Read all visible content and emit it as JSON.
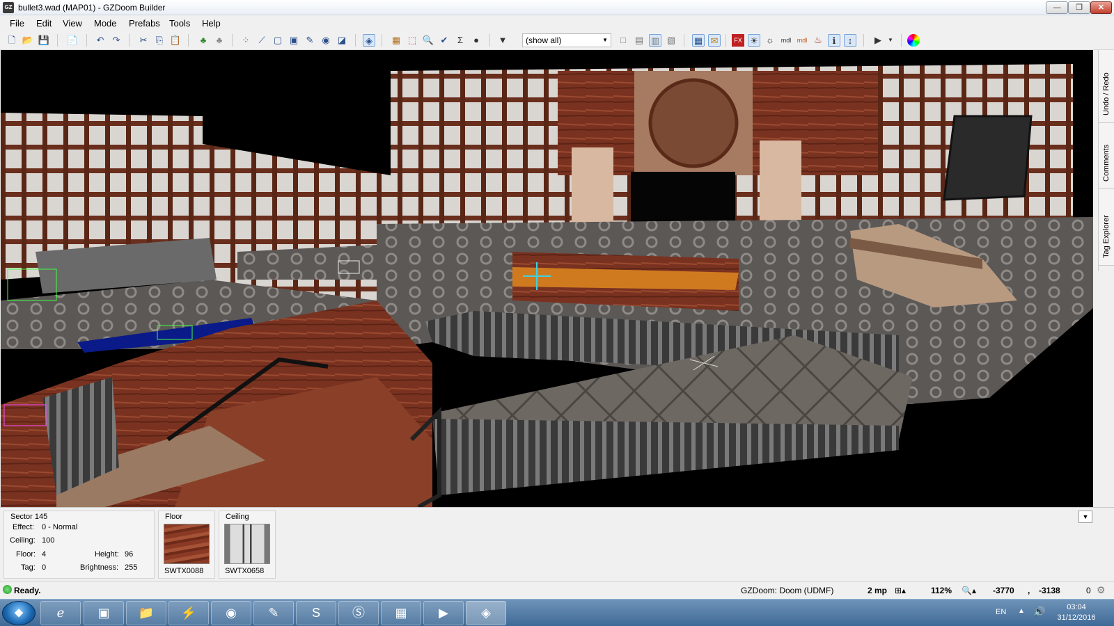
{
  "window": {
    "title": "bullet3.wad (MAP01) - GZDoom Builder",
    "min": "—",
    "max": "❐",
    "close": "✕"
  },
  "menu": [
    "File",
    "Edit",
    "View",
    "Mode",
    "Prefabs",
    "Tools",
    "Help"
  ],
  "toolbar": {
    "filter_value": "(show all)"
  },
  "right_tabs": [
    "Undo / Redo",
    "Comments",
    "Tag Explorer"
  ],
  "sector_info": {
    "title": "Sector 145",
    "effect_label": "Effect:",
    "effect": "0 - Normal",
    "ceiling_label": "Ceiling:",
    "ceiling": "100",
    "floor_label": "Floor:",
    "floor": "4",
    "height_label": "Height:",
    "height": "96",
    "tag_label": "Tag:",
    "tag": "0",
    "brightness_label": "Brightness:",
    "brightness": "255"
  },
  "floor_texture": {
    "label": "Floor",
    "name": "SWTX0088"
  },
  "ceiling_texture": {
    "label": "Ceiling",
    "name": "SWTX0658"
  },
  "status": {
    "message": "Ready.",
    "engine": "GZDoom: Doom (UDMF)",
    "grid": "2 mp",
    "zoom": "112%",
    "coord_x": "-3770",
    "coord_sep": ",",
    "coord_y": "-3138",
    "count": "0"
  },
  "tray": {
    "lang": "EN",
    "time": "03:04",
    "date": "31/12/2016"
  },
  "colors": {
    "accent": "#3b6fb0",
    "viewport_bg": "#000000"
  }
}
